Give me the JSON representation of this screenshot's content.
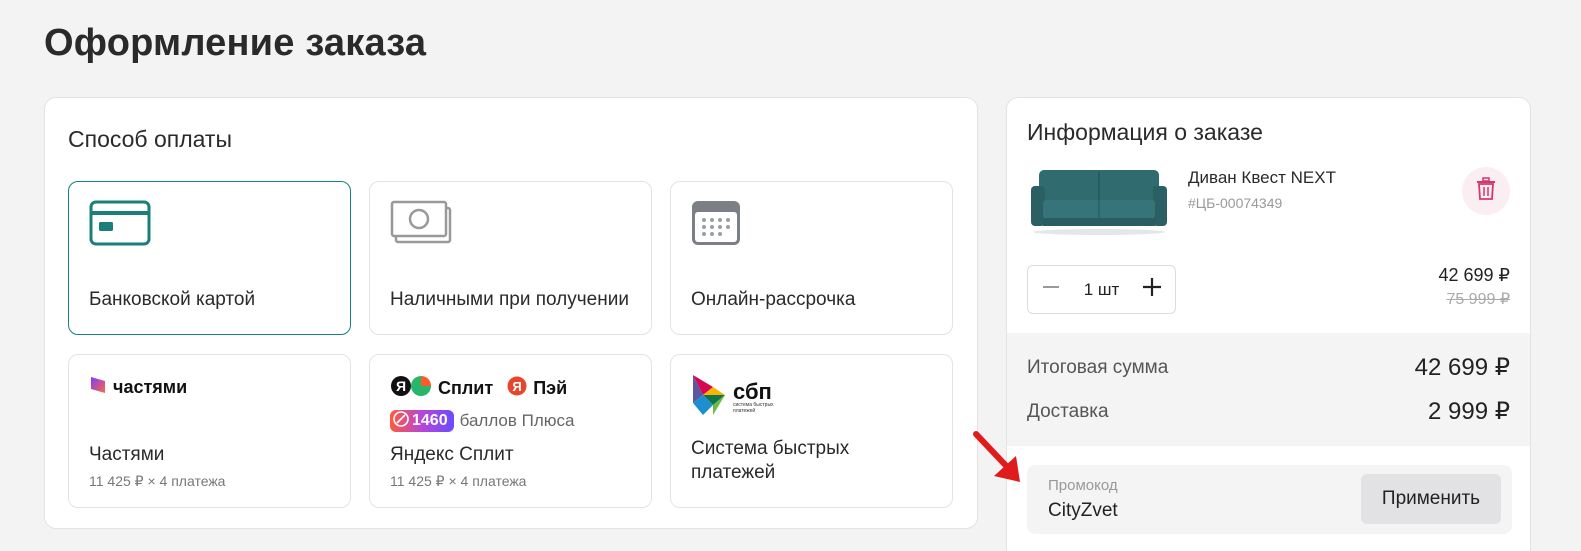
{
  "page": {
    "title": "Оформление заказа"
  },
  "payment": {
    "heading": "Способ оплаты",
    "options": [
      {
        "label": "Банковской картой",
        "icon": "credit-card-icon",
        "selected": true
      },
      {
        "label": "Наличными при получении",
        "icon": "cash-icon"
      },
      {
        "label": "Онлайн-рассрочка",
        "icon": "calendar-icon"
      },
      {
        "label": "Частями",
        "brand": "частями",
        "sub": "11 425 ₽ × 4 платежа",
        "icon": "chastyami-logo-icon"
      },
      {
        "label": "Яндекс Сплит",
        "brand_split": "Сплит",
        "brand_pay": "Пэй",
        "plus_points": "1460",
        "plus_text": "баллов Плюса",
        "sub": "11 425 ₽ × 4 платежа",
        "icon": "yandex-split-logo-icon"
      },
      {
        "label": "Система быстрых платежей",
        "brand": "сбп",
        "brand_small": "система быстрых платежей",
        "icon": "sbp-logo-icon"
      }
    ]
  },
  "order": {
    "heading": "Информация о заказе",
    "product": {
      "name": "Диван Квест NEXT",
      "sku": "#ЦБ-00074349",
      "quantity": "1 шт",
      "price": "42 699 ₽",
      "old_price": "75 999 ₽"
    },
    "summary": {
      "total_label": "Итоговая сумма",
      "total_value": "42 699 ₽",
      "delivery_label": "Доставка",
      "delivery_value": "2 999 ₽"
    },
    "promo": {
      "label": "Промокод",
      "value": "CityZvet",
      "apply_label": "Применить"
    }
  },
  "colors": {
    "accent": "#1a7f7a",
    "delete_bg": "#fbeef2",
    "delete_icon": "#d4376b",
    "arrow": "#e01b1b"
  }
}
